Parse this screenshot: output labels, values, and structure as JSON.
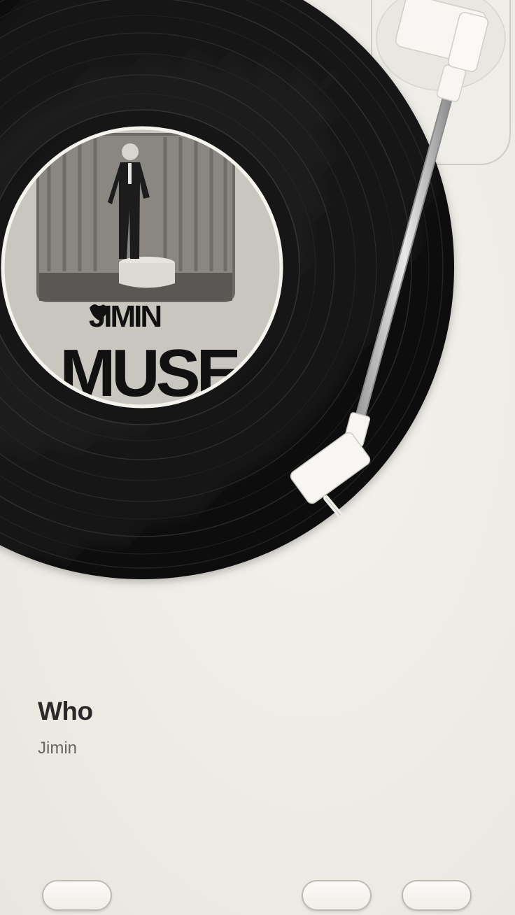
{
  "now_playing": {
    "title": "Who",
    "artist": "Jimin"
  },
  "album_label": {
    "artist_logo": "JIMIN",
    "album_title": "MUSE"
  },
  "controls": {
    "left_button": "",
    "middle_button": "",
    "right_button": ""
  },
  "colors": {
    "background": "#efece6",
    "vinyl": "#0b0b0b",
    "tonearm": "#f7f6f2",
    "title_text": "#2a2a2a",
    "artist_text": "#666666"
  }
}
